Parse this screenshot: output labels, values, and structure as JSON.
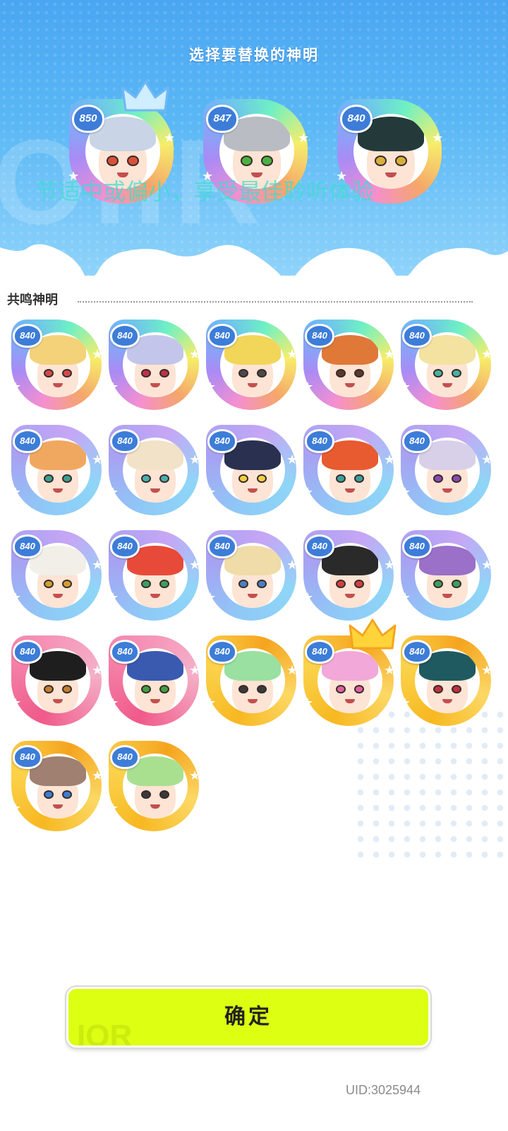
{
  "header": {
    "title": "选择要替换的神明",
    "overlay_text": "节适中或偏小，享受最佳聆听体验"
  },
  "selected": [
    {
      "level": "850",
      "frame": "rainbow",
      "hair": "#c9d4e6",
      "eyes": "#d9503a",
      "crown": "crystal-crown-icon"
    },
    {
      "level": "847",
      "frame": "rainbow",
      "hair": "#b9bcc2",
      "eyes": "#49b043",
      "crown": ""
    },
    {
      "level": "840",
      "frame": "rainbow",
      "hair": "#243a3a",
      "eyes": "#d6b03a",
      "crown": ""
    }
  ],
  "section": {
    "title": "共鸣神明"
  },
  "gods": [
    {
      "level": "840",
      "frame": "rainbow",
      "hair": "#f3d27a",
      "eyes": "#d34a4a"
    },
    {
      "level": "840",
      "frame": "rainbow",
      "hair": "#c3c6ea",
      "eyes": "#c0304a"
    },
    {
      "level": "840",
      "frame": "rainbow",
      "hair": "#f1d65a",
      "eyes": "#4a4a4a"
    },
    {
      "level": "840",
      "frame": "rainbow",
      "hair": "#e07838",
      "eyes": "#5a3a2a"
    },
    {
      "level": "840",
      "frame": "rainbow",
      "hair": "#f3e2a0",
      "eyes": "#4ab0a0"
    },
    {
      "level": "840",
      "frame": "blue",
      "hair": "#f0a860",
      "eyes": "#3aa090"
    },
    {
      "level": "840",
      "frame": "blue",
      "hair": "#f1e2c8",
      "eyes": "#4ab0b0"
    },
    {
      "level": "840",
      "frame": "blue",
      "hair": "#2a3050",
      "eyes": "#f0d040"
    },
    {
      "level": "840",
      "frame": "blue",
      "hair": "#e85a30",
      "eyes": "#3aa0a0"
    },
    {
      "level": "840",
      "frame": "blue",
      "hair": "#d8d0e8",
      "eyes": "#8a4ab0"
    },
    {
      "level": "840",
      "frame": "blue",
      "hair": "#f1efe8",
      "eyes": "#d0a030"
    },
    {
      "level": "840",
      "frame": "blue",
      "hair": "#e84a3a",
      "eyes": "#3aa060"
    },
    {
      "level": "840",
      "frame": "blue",
      "hair": "#f0dca8",
      "eyes": "#4a80c0"
    },
    {
      "level": "840",
      "frame": "blue",
      "hair": "#2a2a2a",
      "eyes": "#d04040"
    },
    {
      "level": "840",
      "frame": "blue",
      "hair": "#9a70c8",
      "eyes": "#3aa060"
    },
    {
      "level": "840",
      "frame": "pink",
      "hair": "#1e1e1e",
      "eyes": "#c08030"
    },
    {
      "level": "840",
      "frame": "pink",
      "hair": "#3a5ab0",
      "eyes": "#40a040"
    },
    {
      "level": "840",
      "frame": "gold",
      "hair": "#9ae0a0",
      "eyes": "#3a3a3a"
    },
    {
      "level": "840",
      "frame": "gold",
      "hair": "#f2a8d8",
      "eyes": "#e060a0",
      "crown": "gold-crown-icon"
    },
    {
      "level": "840",
      "frame": "gold",
      "hair": "#1e5a60",
      "eyes": "#c03040"
    },
    {
      "level": "840",
      "frame": "gold",
      "hair": "#a08070",
      "eyes": "#3a80d0"
    },
    {
      "level": "840",
      "frame": "gold",
      "hair": "#a8e090",
      "eyes": "#3a3a3a"
    }
  ],
  "footer": {
    "confirm_label": "确定",
    "confirm_deco": "IOR",
    "uid": "UID:3025944"
  },
  "colors": {
    "accent": "#dcff12",
    "header_top": "#4aa6f2",
    "level_badge": "#3d7dd8"
  }
}
